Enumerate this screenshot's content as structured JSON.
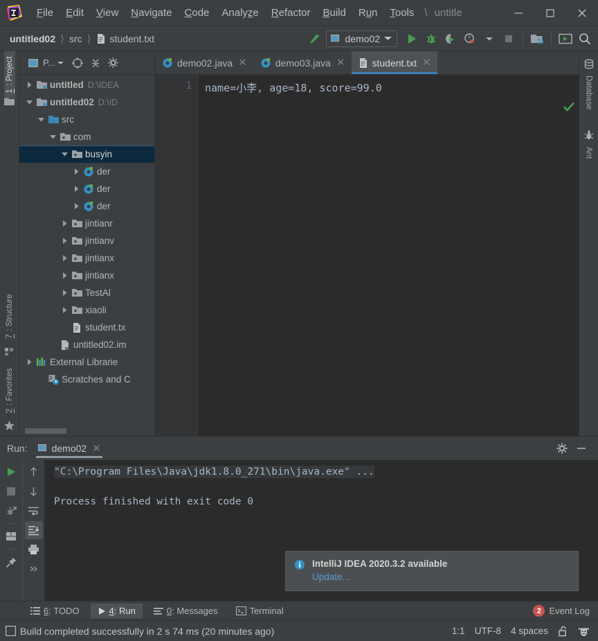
{
  "window": {
    "title": "untitle",
    "path_separator": "\\",
    "minimize_label": "Minimize",
    "maximize_label": "Maximize",
    "close_label": "Close"
  },
  "menubar": {
    "items": [
      {
        "label": "File",
        "mnemonic": "F"
      },
      {
        "label": "Edit",
        "mnemonic": "E"
      },
      {
        "label": "View",
        "mnemonic": "V"
      },
      {
        "label": "Navigate",
        "mnemonic": "N"
      },
      {
        "label": "Code",
        "mnemonic": "C"
      },
      {
        "label": "Analyze",
        "mnemonic": "z"
      },
      {
        "label": "Refactor",
        "mnemonic": "R"
      },
      {
        "label": "Build",
        "mnemonic": "B"
      },
      {
        "label": "Run",
        "mnemonic": "u"
      },
      {
        "label": "Tools",
        "mnemonic": "T"
      }
    ]
  },
  "navbar": {
    "breadcrumbs": [
      {
        "label": "untitled02",
        "icon": "module-icon",
        "bold": true
      },
      {
        "label": "src",
        "icon": "folder-icon",
        "bold": false
      },
      {
        "label": "student.txt",
        "icon": "text-file-icon",
        "bold": false
      }
    ],
    "run_config": "demo02",
    "icons": {
      "build": "hammer-icon",
      "run": "run-icon",
      "debug": "debug-icon",
      "run_coverage": "run-with-coverage-icon",
      "profiler": "profiler-icon",
      "stop": "stop-icon",
      "project_structure": "project-structure-icon",
      "updates": "updates-icon",
      "search": "search-everywhere-icon"
    }
  },
  "left_strip": {
    "top": [
      {
        "label": "1: Project",
        "mnemonic": "1",
        "icon": "project-icon",
        "active": true
      }
    ],
    "bottom": [
      {
        "label": "7: Structure",
        "mnemonic": "7",
        "icon": "structure-icon",
        "active": false
      },
      {
        "label": "2: Favorites",
        "mnemonic": "2",
        "icon": "star-icon",
        "active": false
      }
    ]
  },
  "right_strip": {
    "items": [
      {
        "label": "Database",
        "icon": "database-icon"
      },
      {
        "label": "Ant",
        "icon": "ant-icon"
      }
    ]
  },
  "project_panel": {
    "title": "P...",
    "toolbar_icons": [
      "select-opened-file-icon",
      "collapse-all-icon",
      "settings-gear-icon"
    ],
    "tree": [
      {
        "label": "untitled",
        "path": "D:\\IDEA",
        "icon": "module-icon",
        "indent": 0,
        "twisty": "collapsed",
        "bold": true,
        "selected": false
      },
      {
        "label": "untitled02",
        "path": "D:\\ID",
        "icon": "module-icon",
        "indent": 0,
        "twisty": "expanded",
        "bold": true,
        "selected": false
      },
      {
        "label": "src",
        "path": "",
        "icon": "source-folder-icon",
        "indent": 1,
        "twisty": "expanded",
        "bold": false,
        "selected": false
      },
      {
        "label": "com",
        "path": "",
        "icon": "package-icon",
        "indent": 2,
        "twisty": "expanded",
        "bold": false,
        "selected": false
      },
      {
        "label": "busyin",
        "path": "",
        "icon": "package-icon",
        "indent": 3,
        "twisty": "expanded",
        "bold": false,
        "selected": true
      },
      {
        "label": "der",
        "path": "",
        "icon": "java-class-icon",
        "indent": 4,
        "twisty": "collapsed",
        "bold": false,
        "selected": false
      },
      {
        "label": "der",
        "path": "",
        "icon": "java-class-icon",
        "indent": 4,
        "twisty": "collapsed",
        "bold": false,
        "selected": false
      },
      {
        "label": "der",
        "path": "",
        "icon": "java-class-icon",
        "indent": 4,
        "twisty": "collapsed",
        "bold": false,
        "selected": false
      },
      {
        "label": "jintianr",
        "path": "",
        "icon": "package-icon",
        "indent": 3,
        "twisty": "collapsed",
        "bold": false,
        "selected": false
      },
      {
        "label": "jintianv",
        "path": "",
        "icon": "package-icon",
        "indent": 3,
        "twisty": "collapsed",
        "bold": false,
        "selected": false
      },
      {
        "label": "jintianx",
        "path": "",
        "icon": "package-icon",
        "indent": 3,
        "twisty": "collapsed",
        "bold": false,
        "selected": false
      },
      {
        "label": "jintianx",
        "path": "",
        "icon": "package-icon",
        "indent": 3,
        "twisty": "collapsed",
        "bold": false,
        "selected": false
      },
      {
        "label": "TestAl",
        "path": "",
        "icon": "package-icon",
        "indent": 3,
        "twisty": "collapsed",
        "bold": false,
        "selected": false
      },
      {
        "label": "xiaoli",
        "path": "",
        "icon": "package-icon",
        "indent": 3,
        "twisty": "collapsed",
        "bold": false,
        "selected": false
      },
      {
        "label": "student.tx",
        "path": "",
        "icon": "text-file-icon",
        "indent": 3,
        "twisty": "none",
        "bold": false,
        "selected": false
      },
      {
        "label": "untitled02.im",
        "path": "",
        "icon": "iml-file-icon",
        "indent": 2,
        "twisty": "none",
        "bold": false,
        "selected": false
      },
      {
        "label": "External Librarie",
        "path": "",
        "icon": "libraries-icon",
        "indent": 0,
        "twisty": "collapsed",
        "bold": false,
        "selected": false
      },
      {
        "label": "Scratches and C",
        "path": "",
        "icon": "scratches-icon",
        "indent": 1,
        "twisty": "none",
        "bold": false,
        "selected": false
      }
    ]
  },
  "editor": {
    "tabs": [
      {
        "label": "demo02.java",
        "icon": "java-class-icon",
        "active": false
      },
      {
        "label": "demo03.java",
        "icon": "java-class-icon",
        "active": false
      },
      {
        "label": "student.txt",
        "icon": "text-file-icon",
        "active": true
      }
    ],
    "line_numbers": [
      "1"
    ],
    "content": "name=小李, age=18, score=99.0",
    "inspection_status": "ok-check-icon"
  },
  "run_window": {
    "label": "Run:",
    "tab": "demo02",
    "tab_icon": "run-config-icon",
    "settings_icon": "settings-gear-icon",
    "hide_icon": "minimize-icon",
    "left_tools": [
      "rerun-icon",
      "stop-icon",
      "rerun-failed-icon",
      "layout-icon",
      "pin-tab-icon"
    ],
    "right_tools": [
      "up-icon",
      "down-icon",
      "soft-wrap-icon",
      "scroll-to-end-icon",
      "print-icon",
      "more-icon"
    ],
    "console": {
      "line1": "\"C:\\Program Files\\Java\\jdk1.8.0_271\\bin\\java.exe\" ...",
      "line2": "Process finished with exit code 0"
    }
  },
  "notification": {
    "icon": "info-icon",
    "title": "IntelliJ IDEA 2020.3.2 available",
    "link": "Update..."
  },
  "bottom_bar": {
    "items": [
      {
        "label": "6: TODO",
        "mnemonic": "6",
        "icon": "todo-icon",
        "active": false
      },
      {
        "label": "4: Run",
        "mnemonic": "4",
        "icon": "run-icon",
        "active": true
      },
      {
        "label": "0: Messages",
        "mnemonic": "0",
        "icon": "messages-icon",
        "active": false
      },
      {
        "label": "Terminal",
        "mnemonic": "",
        "icon": "terminal-icon",
        "active": false
      }
    ],
    "event_log": {
      "label": "Event Log",
      "count": "2"
    }
  },
  "status_bar": {
    "message": "Build completed successfully in 2 s 74 ms (20 minutes ago)",
    "caret": "1:1",
    "encoding": "UTF-8",
    "indent": "4 spaces",
    "lock_icon": "unlocked-icon",
    "inspector_icon": "hector-icon"
  },
  "colors": {
    "accent_blue": "#3d7eb8",
    "run_green": "#499c54",
    "link_blue": "#5b9bd5",
    "badge_red": "#c75450",
    "selection_navy": "#0d293e",
    "editor_bg": "#2b2b2b",
    "chrome_bg": "#3c3f41"
  }
}
